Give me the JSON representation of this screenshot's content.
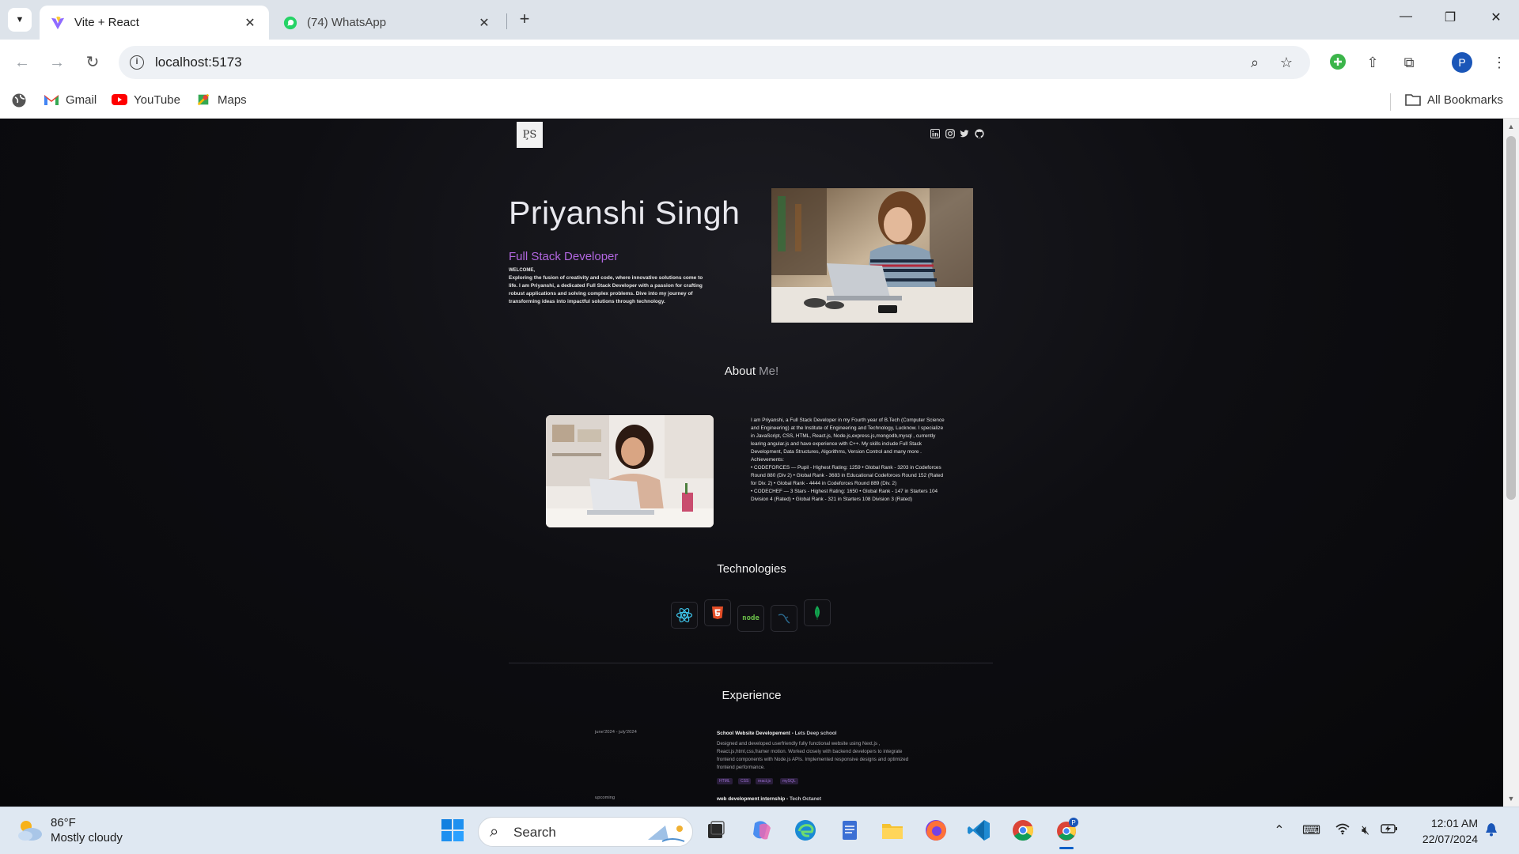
{
  "browser": {
    "tabs": [
      {
        "title": "Vite + React",
        "active": true
      },
      {
        "title": "(74) WhatsApp",
        "active": false
      }
    ],
    "url": "localhost:5173",
    "bookmarks": [
      "Gmail",
      "YouTube",
      "Maps"
    ],
    "all_bookmarks": "All Bookmarks",
    "profile_initial": "P"
  },
  "page": {
    "logo": "P̧S",
    "hero": {
      "name": "Priyanshi Singh",
      "role": "Full Stack Developer",
      "welcome": "WELCOME,",
      "intro": "Exploring the fusion of creativity and code, where innovative solutions come to life. I am Priyanshi, a dedicated Full Stack Developer with a passion for crafting robust applications and solving complex problems. Dive into my journey of transforming ideas into impactful solutions through technology."
    },
    "about": {
      "title": "About",
      "title_accent": "Me!",
      "text": "I am Priyanshi, a Full Stack Developer in my Fourth year of B.Tech (Computer Science and Engineering) at the Institute of Engineering and Technology, Lucknow. I specialize in JavaScript, CSS, HTML, React.js, Node.js,express.js,mongodb,mysql , currently learing angular.js and have experience with C++. My skills include Full Stack Development, Data Structures, Algorithms, Version Control and many more .",
      "achievements_label": "Achievements:",
      "achievement_1": "• CODEFORCES — Pupil - Highest Rating: 1259 • Global Rank - 3203 in Codeforces Round 880 (Div 2) • Global Rank - 3683 in Educational Codeforces Round 152 (Rated for Div. 2) • Global Rank - 4444 in Codeforces Round 889 (Div. 2)",
      "achievement_2": "• CODECHEF — 3 Stars - Highest Rating: 1650 • Global Rank - 147 in Starters 104 Division 4 (Rated) • Global Rank - 321 in Starters 108 Division 3 (Rated)"
    },
    "technologies": {
      "title": "Technologies",
      "items": [
        "react-icon",
        "html5-icon",
        "nodejs-icon",
        "mysql-icon",
        "mongodb-icon"
      ]
    },
    "experience": {
      "title": "Experience",
      "items": [
        {
          "date": "june'2024 - july'2024",
          "title": "School Website Developement - ",
          "company": "Lets Deep school",
          "description": "Designed and developed userfriendly fully functional website using Next.js , React.js,html,css,framer motion. Worked closely with backend developers to integrate frontend components with Node.js APIs. Implemented responsive designs and optimized frontend performance.",
          "tags": [
            "HTML",
            "CSS",
            "react.js",
            "mySQL"
          ]
        },
        {
          "date": "upcoming",
          "title": "web development internship - ",
          "company": "Tech Octanet"
        }
      ]
    }
  },
  "taskbar": {
    "weather_temp": "86°F",
    "weather_desc": "Mostly cloudy",
    "search": "Search",
    "time": "12:01 AM",
    "date": "22/07/2024"
  },
  "colors": {
    "accent_purple": "#b267e0",
    "page_bg": "#0e0e12",
    "chrome_tab_bg": "#dde3ea"
  }
}
